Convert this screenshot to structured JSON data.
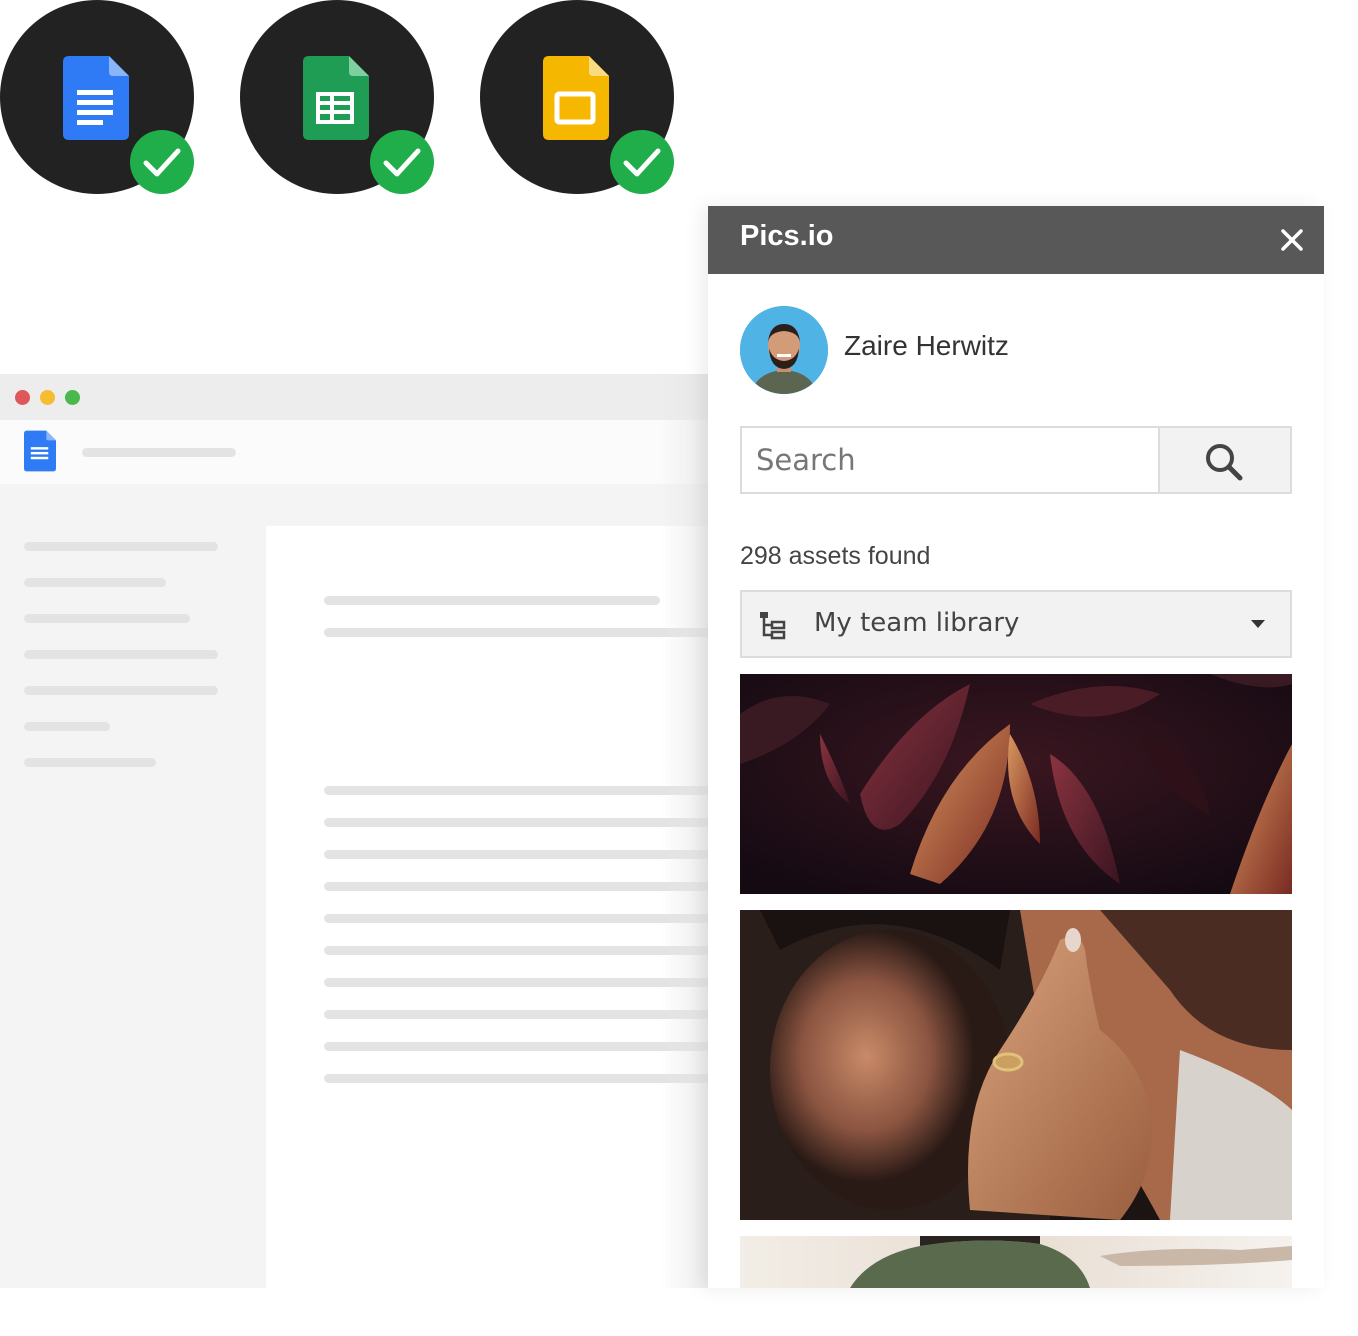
{
  "panel": {
    "title": "Pics.io",
    "user": {
      "name": "Zaire Herwitz"
    },
    "search": {
      "placeholder": "Search"
    },
    "assets_found": "298 assets found",
    "library": {
      "selected": "My team library"
    },
    "thumbnails": [
      {
        "subject": "autumn-leaves-photo"
      },
      {
        "subject": "engagement-ring-couple-photo"
      },
      {
        "subject": "partial-photo"
      }
    ]
  },
  "apps": [
    {
      "name": "google-docs-icon",
      "color": "#2f7bf5",
      "status": "check-icon"
    },
    {
      "name": "google-sheets-icon",
      "color": "#1f9d55",
      "status": "check-icon"
    },
    {
      "name": "google-slides-icon",
      "color": "#f5b700",
      "status": "check-icon"
    }
  ],
  "colors": {
    "header": "#585858",
    "check": "#1fae49",
    "window_red": "#e0575b",
    "window_yellow": "#f5bd2f",
    "window_green": "#49b84d"
  }
}
